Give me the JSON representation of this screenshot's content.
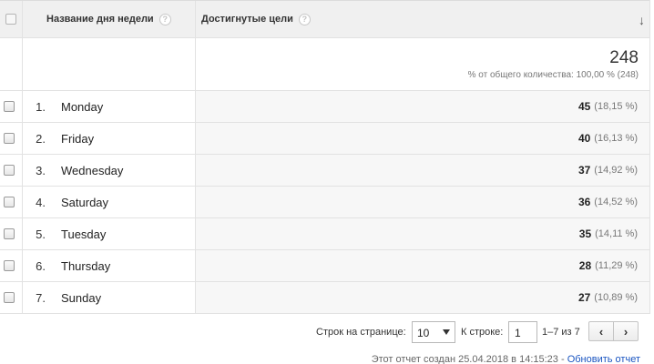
{
  "header": {
    "dimension_label": "Название дня недели",
    "metric_label": "Достигнутые цели",
    "sort_icon": "arrow-down-icon",
    "help_icon_glyph": "?"
  },
  "totals": {
    "value": "248",
    "subtitle": "% от общего количества: 100,00 % (248)"
  },
  "rows": [
    {
      "index": "1.",
      "day": "Monday",
      "value": "45",
      "percent": "(18,15 %)"
    },
    {
      "index": "2.",
      "day": "Friday",
      "value": "40",
      "percent": "(16,13 %)"
    },
    {
      "index": "3.",
      "day": "Wednesday",
      "value": "37",
      "percent": "(14,92 %)"
    },
    {
      "index": "4.",
      "day": "Saturday",
      "value": "36",
      "percent": "(14,52 %)"
    },
    {
      "index": "5.",
      "day": "Tuesday",
      "value": "35",
      "percent": "(14,11 %)"
    },
    {
      "index": "6.",
      "day": "Thursday",
      "value": "28",
      "percent": "(11,29 %)"
    },
    {
      "index": "7.",
      "day": "Sunday",
      "value": "27",
      "percent": "(10,89 %)"
    }
  ],
  "pager": {
    "rows_per_page_label": "Строк на странице:",
    "rows_per_page_value": "10",
    "goto_label": "К строке:",
    "goto_value": "1",
    "range_text": "1–7 из 7",
    "prev_glyph": "‹",
    "next_glyph": "›"
  },
  "footer": {
    "created_text": "Этот отчет создан 25.04.2018 в 14:15:23 - ",
    "refresh_link": "Обновить отчет"
  }
}
